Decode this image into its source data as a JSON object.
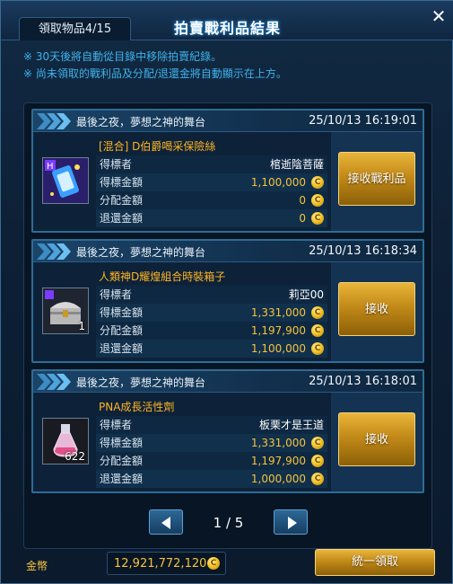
{
  "header": {
    "claim_count": "領取物品4/15",
    "title": "拍賣戰利品結果",
    "close_label": "✕"
  },
  "notices": [
    "※ 30天後將自動從目錄中移除拍賣紀錄。",
    "※ 尚未領取的戰利品及分配/退還金將自動顯示在上方。"
  ],
  "cards": [
    {
      "map_name": "最後之夜，夢想之神的舞台",
      "timestamp": "25/10/13 16:19:01",
      "item_name": "[混合] D伯爵喝采保險絲",
      "icon": "fuse-box-icon",
      "qty": "",
      "rows": [
        {
          "label": "得標者",
          "value": "棺逝陰菩薩",
          "coin": false
        },
        {
          "label": "得標金額",
          "value": "1,100,000",
          "coin": true
        },
        {
          "label": "分配金額",
          "value": "0",
          "coin": true
        },
        {
          "label": "退還金額",
          "value": "0",
          "coin": true
        }
      ],
      "action_label": "接收戰利品"
    },
    {
      "map_name": "最後之夜，夢想之神的舞台",
      "timestamp": "25/10/13 16:18:34",
      "item_name": "人類神D耀煌組合時裝箱子",
      "icon": "treasure-chest-icon",
      "qty": "1",
      "rows": [
        {
          "label": "得標者",
          "value": "莉亞00",
          "coin": false
        },
        {
          "label": "得標金額",
          "value": "1,331,000",
          "coin": true
        },
        {
          "label": "分配金額",
          "value": "1,197,900",
          "coin": true
        },
        {
          "label": "退還金額",
          "value": "1,100,000",
          "coin": true
        }
      ],
      "action_label": "接收"
    },
    {
      "map_name": "最後之夜，夢想之神的舞台",
      "timestamp": "25/10/13 16:18:01",
      "item_name": "PNA成長活性劑",
      "icon": "potion-flask-icon",
      "qty": "622",
      "rows": [
        {
          "label": "得標者",
          "value": "板栗才是王道",
          "coin": false
        },
        {
          "label": "得標金額",
          "value": "1,331,000",
          "coin": true
        },
        {
          "label": "分配金額",
          "value": "1,197,900",
          "coin": true
        },
        {
          "label": "退還金額",
          "value": "1,000,000",
          "coin": true
        }
      ],
      "action_label": "接收"
    }
  ],
  "pager": {
    "label": "1 / 5"
  },
  "footer": {
    "money_label": "金幣",
    "money_value": "12,921,772,120",
    "claim_all_label": "統一領取"
  },
  "colors": {
    "accent_gold": "#f5c33c",
    "item_name": "#ffb424",
    "notice_blue": "#3fb3ea",
    "card_border": "#2e6c96"
  }
}
